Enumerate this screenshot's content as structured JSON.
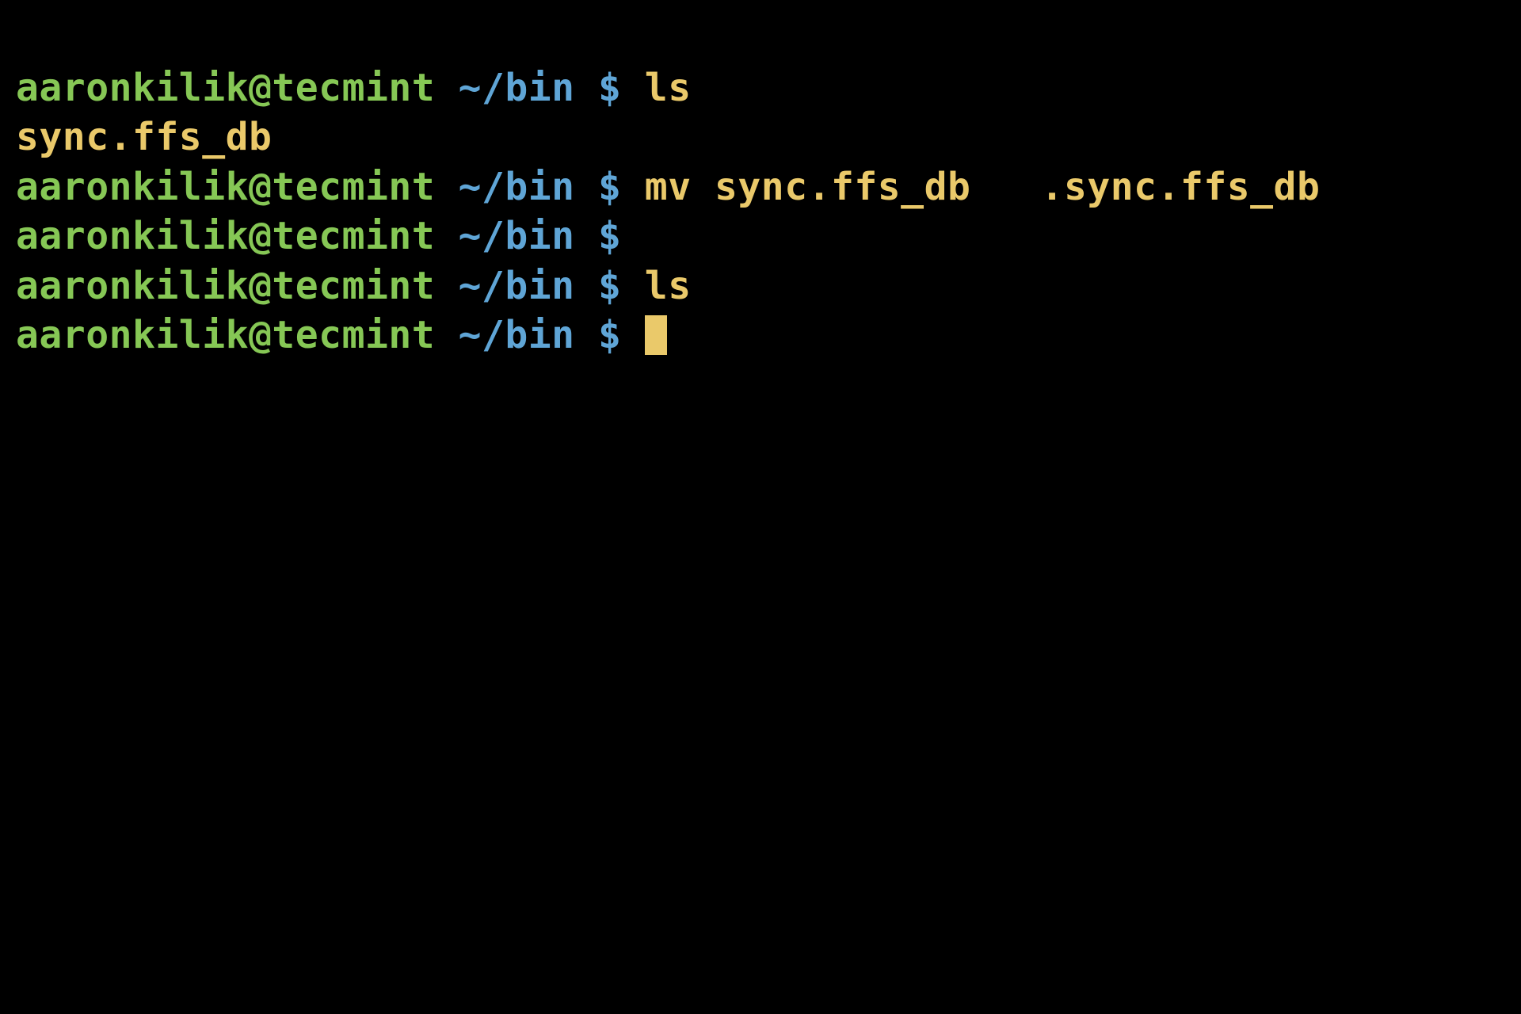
{
  "prompt": {
    "user_host": "aaronkilik@tecmint",
    "path": "~/bin",
    "symbol": "$"
  },
  "lines": [
    {
      "type": "prompt",
      "command": "ls"
    },
    {
      "type": "output",
      "text": "sync.ffs_db"
    },
    {
      "type": "prompt",
      "command": "mv sync.ffs_db   .sync.ffs_db"
    },
    {
      "type": "prompt",
      "command": ""
    },
    {
      "type": "prompt",
      "command": "ls"
    },
    {
      "type": "prompt",
      "command": "",
      "cursor": true
    }
  ],
  "colors": {
    "background": "#000000",
    "user_host": "#86c755",
    "path": "#5fa5d6",
    "command": "#eac96a",
    "output": "#eac96a",
    "cursor": "#eac96a"
  }
}
